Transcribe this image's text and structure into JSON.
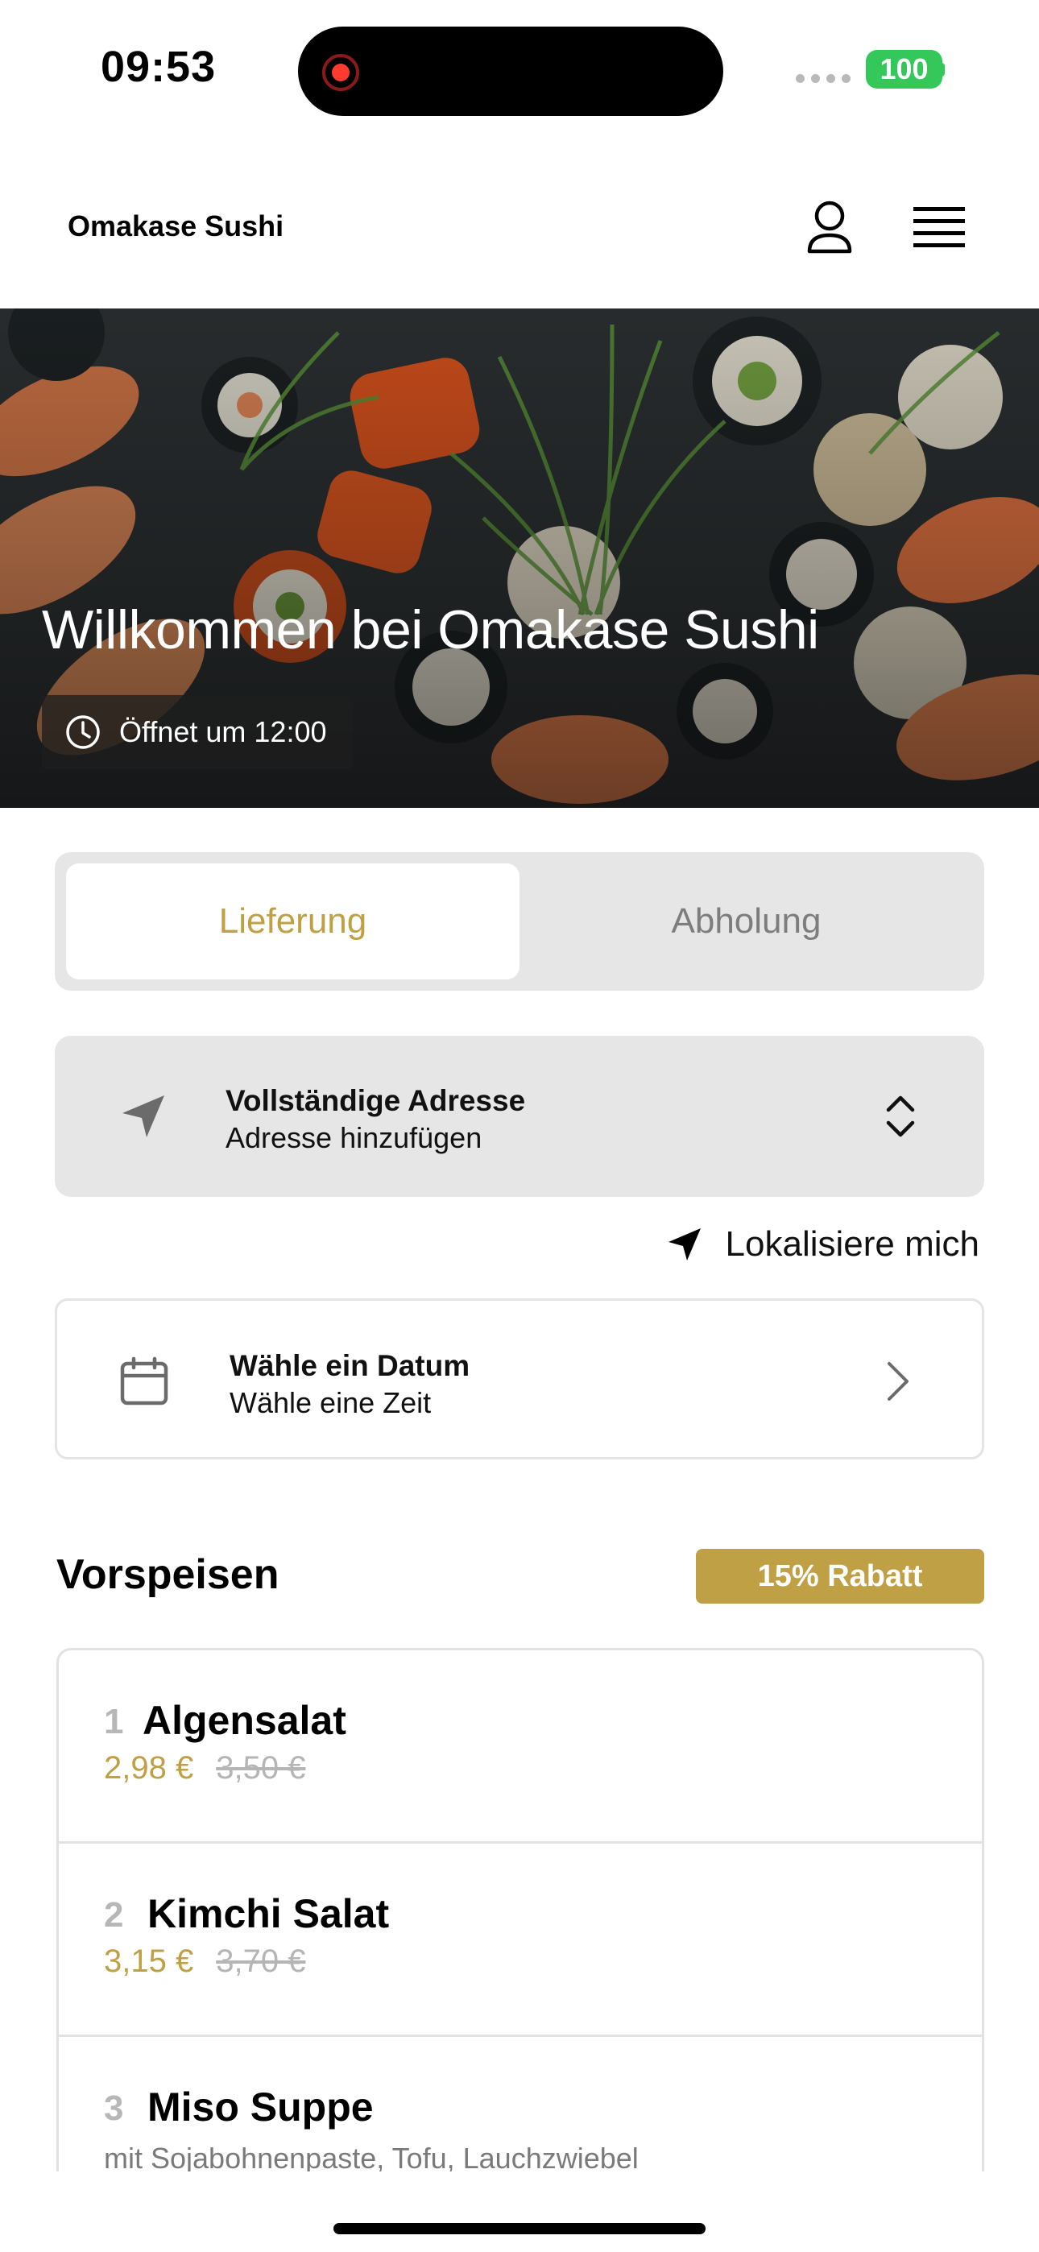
{
  "status_bar": {
    "time": "09:53",
    "battery": "100",
    "icons": [
      "recording-icon",
      "signal-icon",
      "battery-icon"
    ]
  },
  "header": {
    "brand": "Omakase Sushi",
    "icons": [
      "profile-icon",
      "hamburger-menu-icon"
    ]
  },
  "hero": {
    "title": "Willkommen bei Omakase Sushi",
    "hours": "Öffnet um 12:00",
    "icon": "clock-icon"
  },
  "mode_toggle": {
    "tabs": [
      {
        "label": "Lieferung",
        "active": true
      },
      {
        "label": "Abholung",
        "active": false
      }
    ]
  },
  "address": {
    "title": "Vollständige Adresse",
    "subtitle": "Adresse hinzufügen",
    "icon": "location-arrow-icon",
    "right_icon": "chevron-up-down-icon"
  },
  "locate": {
    "label": "Lokalisiere mich",
    "icon": "location-arrow-icon"
  },
  "schedule": {
    "title": "Wähle ein Datum",
    "subtitle": "Wähle eine Zeit",
    "icon": "calendar-icon",
    "right_icon": "chevron-right-icon"
  },
  "category": {
    "title": "Vorspeisen",
    "badge": "15% Rabatt",
    "items": [
      {
        "number": "1",
        "name": "Algensalat",
        "price": "2,98 €",
        "old_price": "3,50 €"
      },
      {
        "number": "2",
        "name": "Kimchi Salat",
        "price": "3,15 €",
        "old_price": "3,70 €"
      },
      {
        "number": "3",
        "name": "Miso Suppe",
        "description": "mit Sojabohnenpaste, Tofu, Lauchzwiebel"
      }
    ]
  },
  "colors": {
    "accent_gold": "#bfa045",
    "battery_green": "#34c759",
    "card_gray": "#e6e6e6"
  }
}
